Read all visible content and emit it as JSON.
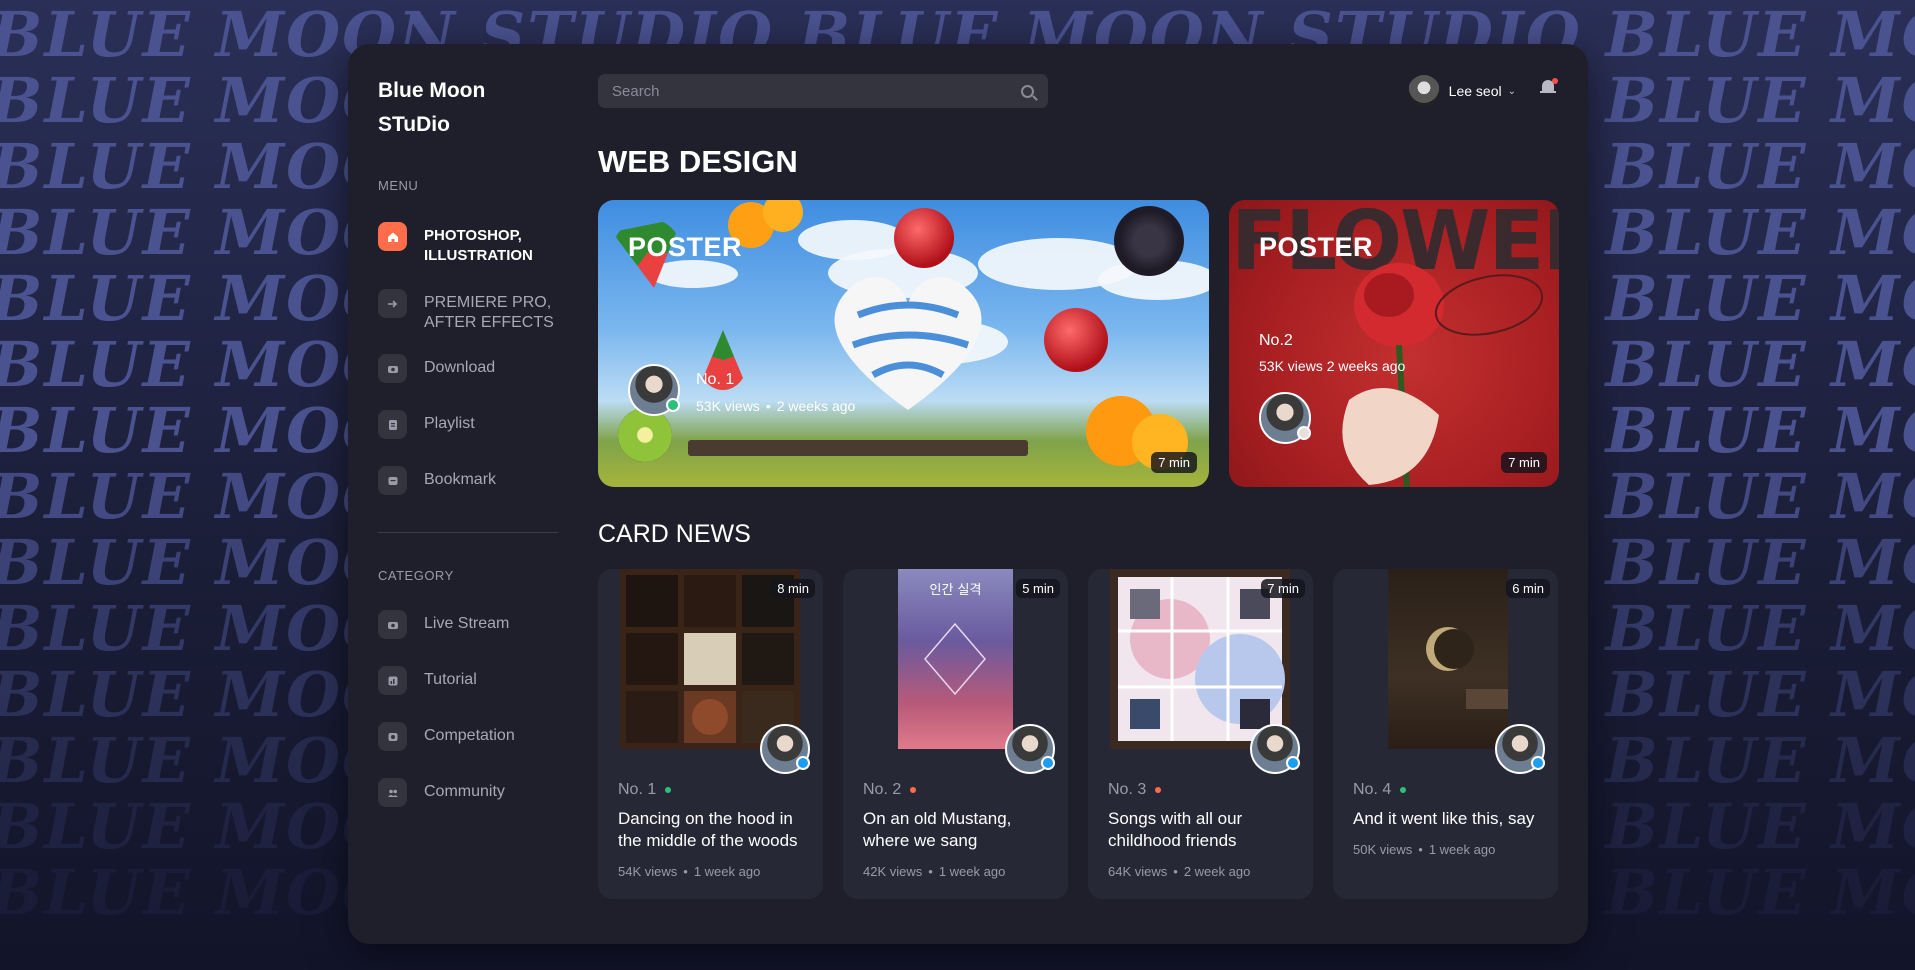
{
  "background": {
    "watermark_text": "BLUE MOON STUDIO BLUE MOON STUDIO BLUE MOON STUDIO BLUE MOON STUDIO",
    "watermark_short": "BLUE MOON"
  },
  "brand": {
    "line1": "Blue Moon",
    "line2": "STuDio"
  },
  "sidebar": {
    "menu_label": "MENU",
    "menu_items": [
      {
        "label": "PHOTOSHOP,\nILLUSTRATION",
        "icon": "home-icon",
        "active": true
      },
      {
        "label": "PREMIERE PRO,\nAFTER EFFECTS",
        "icon": "arrow-icon",
        "active": false
      },
      {
        "label": "Download",
        "icon": "download-icon",
        "active": false
      },
      {
        "label": "Playlist",
        "icon": "playlist-icon",
        "active": false
      },
      {
        "label": "Bookmark",
        "icon": "bookmark-icon",
        "active": false
      }
    ],
    "category_label": "CATEGORY",
    "category_items": [
      {
        "label": "Live Stream",
        "icon": "live-icon"
      },
      {
        "label": "Tutorial",
        "icon": "tutorial-icon"
      },
      {
        "label": "Competation",
        "icon": "competition-icon"
      },
      {
        "label": "Community",
        "icon": "community-icon"
      }
    ]
  },
  "header": {
    "search_placeholder": "Search",
    "user_name": "Lee seol"
  },
  "web_design": {
    "title": "WEB DESIGN",
    "posters": [
      {
        "title": "POSTER",
        "number": "No. 1",
        "views": "53K views",
        "age": "2 weeks ago",
        "duration": "7 min"
      },
      {
        "title": "POSTER",
        "number": "No.2",
        "meta": "53K views 2 weeks ago",
        "duration": "7 min",
        "bg_word": "FLOWER"
      }
    ]
  },
  "card_news": {
    "title": "CARD NEWS",
    "cards": [
      {
        "number": "No. 1",
        "dot_color": "#2dbf7c",
        "title": "Dancing on the hood in the middle of the woods",
        "views": "54K views",
        "age": "1 week ago",
        "duration": "8 min"
      },
      {
        "number": "No. 2",
        "dot_color": "#ff6d4a",
        "title": "On an old Mustang, where we sang",
        "views": "42K views",
        "age": "1 week ago",
        "duration": "5 min",
        "thumb_text": "인간 실격"
      },
      {
        "number": "No. 3",
        "dot_color": "#ff6d4a",
        "title": "Songs with all our childhood friends",
        "views": "64K views",
        "age": "2 week ago",
        "duration": "7 min"
      },
      {
        "number": "No. 4",
        "dot_color": "#2dbf7c",
        "title": "And it went like this, say",
        "views": "50K views",
        "age": "1 week ago",
        "duration": "6 min"
      }
    ]
  }
}
